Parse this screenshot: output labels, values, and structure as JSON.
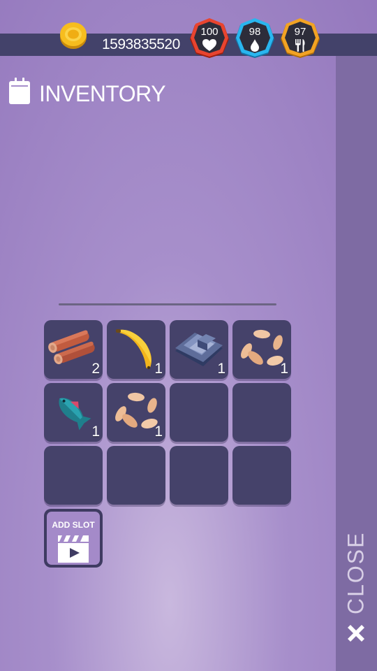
{
  "header": {
    "coins": "1593835520",
    "coin_icon": "gold-coin-icon",
    "stats": [
      {
        "name": "health",
        "value": "100",
        "icon": "heart-icon",
        "ring_color": "#e8442f"
      },
      {
        "name": "water",
        "value": "98",
        "icon": "water-drop-icon",
        "ring_color": "#29b6ef"
      },
      {
        "name": "food",
        "value": "97",
        "icon": "fork-knife-icon",
        "ring_color": "#f2a323"
      }
    ]
  },
  "inventory": {
    "title": "INVENTORY",
    "icon": "backpack-icon",
    "slots": [
      {
        "item": "wood-logs",
        "icon": "wood-logs-icon",
        "qty": "2"
      },
      {
        "item": "banana",
        "icon": "banana-icon",
        "qty": "1"
      },
      {
        "item": "stone",
        "icon": "stone-icon",
        "qty": "1"
      },
      {
        "item": "seeds",
        "icon": "seeds-icon",
        "qty": "1"
      },
      {
        "item": "fish",
        "icon": "fish-icon",
        "qty": "1"
      },
      {
        "item": "seeds",
        "icon": "seeds-icon",
        "qty": "1"
      },
      {
        "item": "",
        "qty": ""
      },
      {
        "item": "",
        "qty": ""
      },
      {
        "item": "",
        "qty": ""
      },
      {
        "item": "",
        "qty": ""
      },
      {
        "item": "",
        "qty": ""
      },
      {
        "item": "",
        "qty": ""
      }
    ],
    "add_slot_label": "ADD SLOT",
    "add_slot_icon": "video-clapper-icon"
  },
  "side": {
    "close_label": "CLOSE",
    "close_icon": "close-x-icon"
  }
}
